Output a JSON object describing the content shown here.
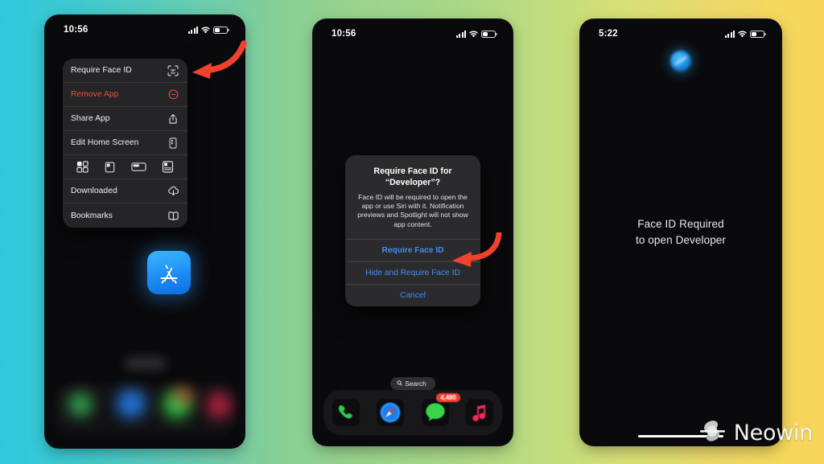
{
  "background": {
    "gradient_from": "#2ec8dd",
    "gradient_mid": "#9bd38c",
    "gradient_to": "#f7d558"
  },
  "phone1": {
    "status": {
      "time": "10:56",
      "signal_icon": "cellular-bars-icon",
      "wifi_icon": "wifi-icon",
      "battery_icon": "battery-icon"
    },
    "context_menu": {
      "items": [
        {
          "label": "Require Face ID",
          "icon": "faceid-icon",
          "destructive": false
        },
        {
          "label": "Remove App",
          "icon": "minus-circle-icon",
          "destructive": true
        },
        {
          "label": "Share App",
          "icon": "share-icon",
          "destructive": false
        },
        {
          "label": "Edit Home Screen",
          "icon": "edit-home-screen-icon",
          "destructive": false
        }
      ],
      "widget_sizes": [
        {
          "name": "widget-size-small-icon"
        },
        {
          "name": "widget-size-medium-icon"
        },
        {
          "name": "widget-size-wide-icon"
        },
        {
          "name": "widget-size-large-icon"
        }
      ],
      "extra_items": [
        {
          "label": "Downloaded",
          "icon": "cloud-download-icon"
        },
        {
          "label": "Bookmarks",
          "icon": "book-icon"
        }
      ]
    },
    "app_icon": {
      "name": "app-store-icon"
    },
    "arrow": {
      "name": "red-arrow-pointing-to-require-face-id",
      "color": "#f0412f"
    }
  },
  "phone2": {
    "status": {
      "time": "10:56"
    },
    "alert": {
      "title": "Require Face ID for\n“Developer”?",
      "title_line1": "Require Face ID for",
      "title_line2": "“Developer”?",
      "message": "Face ID will be required to open the app or use Siri with it. Notification previews and Spotlight will not show app content.",
      "buttons": [
        {
          "label": "Require Face ID",
          "emphasis": "bold"
        },
        {
          "label": "Hide and Require Face ID",
          "emphasis": "normal"
        },
        {
          "label": "Cancel",
          "emphasis": "normal"
        }
      ]
    },
    "search_pill": {
      "label": "Search",
      "icon": "search-icon"
    },
    "dock": [
      {
        "name": "phone-app-icon",
        "label": "Phone",
        "badge": null,
        "color": "#2ecc51"
      },
      {
        "name": "safari-app-icon",
        "label": "Safari",
        "badge": null,
        "color": "#1b7ee8"
      },
      {
        "name": "messages-app-icon",
        "label": "Messages",
        "badge": "4,480",
        "color": "#37d64a"
      },
      {
        "name": "music-app-icon",
        "label": "Music",
        "badge": null,
        "color": "#f5295c"
      }
    ],
    "arrow": {
      "name": "red-arrow-pointing-to-require-face-id-button",
      "color": "#f0412f"
    }
  },
  "phone3": {
    "status": {
      "time": "5:22"
    },
    "blurred_icon": {
      "name": "developer-app-icon"
    },
    "message_line1": "Face ID Required",
    "message_line2": "to open Developer",
    "home_indicator": {
      "name": "home-indicator"
    }
  },
  "watermark": {
    "text": "Neowin",
    "logo": "neowin-logo-icon"
  }
}
